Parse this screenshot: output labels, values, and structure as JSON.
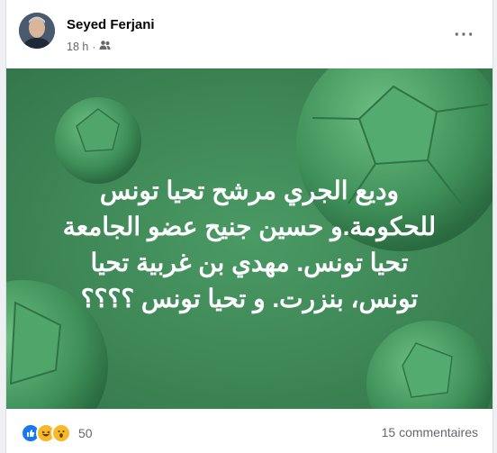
{
  "post": {
    "author": "Seyed Ferjani",
    "time": "18 h",
    "audience_icon": "friends-icon",
    "menu_icon": "more-options-icon",
    "image": {
      "background": "#3f8a59",
      "lines": [
        "وديع الجري مرشح تحيا تونس",
        "للحكومة.و حسين جنيح عضو الجامعة",
        "تحيا تونس. مهدي بن غربية تحيا",
        "تونس، بنزرت. و تحيا تونس ؟؟؟؟"
      ]
    },
    "reactions": {
      "icons": [
        "like-icon",
        "haha-icon",
        "wow-icon"
      ],
      "count": "50"
    },
    "comments": "15 commentaires"
  }
}
